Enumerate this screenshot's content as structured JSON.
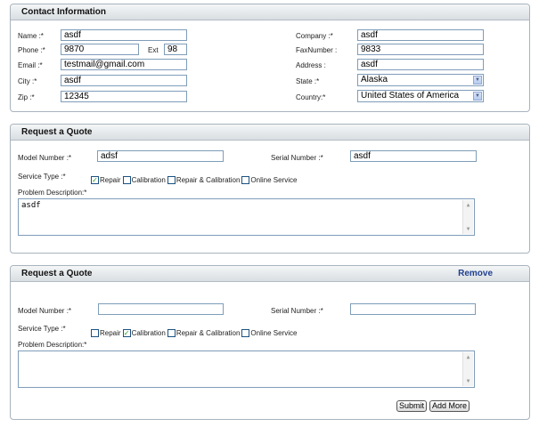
{
  "contact": {
    "title": "Contact Information",
    "name_label": "Name :*",
    "name_value": "asdf",
    "phone_label": "Phone :*",
    "phone_value": "9870",
    "ext_label": "Ext",
    "ext_value": "98",
    "email_label": "Email :*",
    "email_value": "testmail@gmail.com",
    "city_label": "City :*",
    "city_value": "asdf",
    "zip_label": "Zip :*",
    "zip_value": "12345",
    "company_label": "Company :*",
    "company_value": "asdf",
    "fax_label": "FaxNumber :",
    "fax_value": "9833",
    "address_label": "Address :",
    "address_value": "asdf",
    "state_label": "State :*",
    "state_value": "Alaska",
    "country_label": "Country:*",
    "country_value": "United States of America"
  },
  "quote1": {
    "title": "Request a Quote",
    "model_label": "Model Number :*",
    "model_value": "adsf",
    "serial_label": "Serial Number :*",
    "serial_value": "asdf",
    "service_label": "Service Type :*",
    "services": [
      {
        "label": "Repair",
        "checked": true
      },
      {
        "label": "Calibration",
        "checked": false
      },
      {
        "label": "Repair & Calibration",
        "checked": false
      },
      {
        "label": "Online Service",
        "checked": false
      }
    ],
    "problem_label": "Problem Description:*",
    "problem_value": "asdf"
  },
  "quote2": {
    "title": "Request a Quote",
    "remove_label": "Remove",
    "model_label": "Model Number :*",
    "model_value": "",
    "serial_label": "Serial Number :*",
    "serial_value": "",
    "service_label": "Service Type :*",
    "services": [
      {
        "label": "Repair",
        "checked": false
      },
      {
        "label": "Calibration",
        "checked": true
      },
      {
        "label": "Repair & Calibration",
        "checked": false
      },
      {
        "label": "Online Service",
        "checked": false
      }
    ],
    "problem_label": "Problem Description:*",
    "problem_value": ""
  },
  "actions": {
    "submit_label": "Submit",
    "add_more_label": "Add More"
  },
  "colors": {
    "check_mark": "#21a121",
    "remove_link": "#1f3f8f"
  },
  "icons": {
    "checkbox_checked": "check-icon",
    "select_arrow": "chevron-down-icon",
    "scroll_up": "scroll-up-arrow-icon",
    "scroll_down": "scroll-down-arrow-icon"
  }
}
